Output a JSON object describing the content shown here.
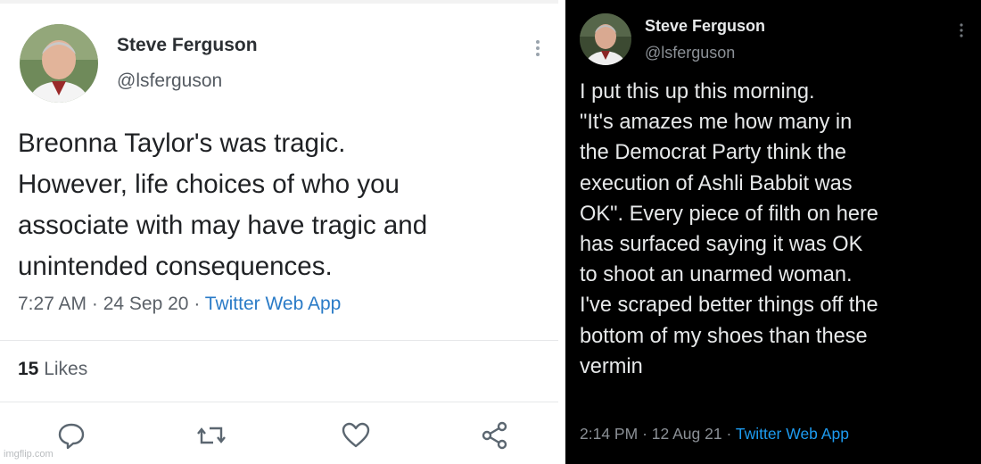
{
  "left_tweet": {
    "author_name": "Steve Ferguson",
    "author_handle": "@lsferguson",
    "text_lines": [
      "Breonna Taylor's was tragic.",
      "However, life choices of who you",
      "associate with may have tragic and",
      "unintended consequences."
    ],
    "time": "7:27 AM",
    "date": "24 Sep 20",
    "source_app": "Twitter Web App",
    "likes_count": "15",
    "likes_label": "Likes",
    "actions": [
      "reply-icon",
      "retweet-icon",
      "like-icon",
      "share-icon"
    ],
    "watermark": "imgflip.com"
  },
  "right_tweet": {
    "author_name": "Steve Ferguson",
    "author_handle": "@lsferguson",
    "text_lines": [
      "I put this up this morning.",
      "\"It's amazes me how many in",
      "the Democrat Party think the",
      "execution of Ashli Babbit was",
      "OK\". Every piece of filth on here",
      "has surfaced saying it was OK",
      "to shoot an unarmed woman.",
      "I've scraped better things off the",
      "bottom of my shoes than these",
      "vermin"
    ],
    "time": "2:14 PM",
    "date": "12 Aug 21",
    "source_app": "Twitter Web App"
  },
  "colors": {
    "left_bg": "#ffffff",
    "right_bg": "#000000",
    "link_blue_left": "#2a7bc7",
    "link_blue_right": "#1d9bf0"
  }
}
